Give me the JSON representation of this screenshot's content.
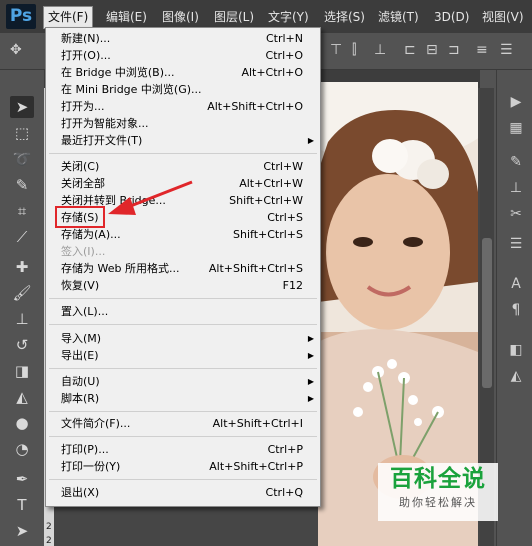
{
  "app": {
    "logo": "Ps"
  },
  "menubar": {
    "items": [
      "文件(F)",
      "编辑(E)",
      "图像(I)",
      "图层(L)",
      "文字(Y)",
      "选择(S)",
      "滤镜(T)",
      "3D(D)",
      "视图(V)"
    ]
  },
  "file_menu": {
    "items": [
      {
        "label": "新建(N)...",
        "shortcut": "Ctrl+N"
      },
      {
        "label": "打开(O)...",
        "shortcut": "Ctrl+O"
      },
      {
        "label": "在 Bridge 中浏览(B)...",
        "shortcut": "Alt+Ctrl+O"
      },
      {
        "label": "在 Mini Bridge 中浏览(G)...",
        "shortcut": ""
      },
      {
        "label": "打开为...",
        "shortcut": "Alt+Shift+Ctrl+O"
      },
      {
        "label": "打开为智能对象...",
        "shortcut": ""
      },
      {
        "label": "最近打开文件(T)",
        "shortcut": ""
      },
      {
        "label": "关闭(C)",
        "shortcut": "Ctrl+W"
      },
      {
        "label": "关闭全部",
        "shortcut": "Alt+Ctrl+W"
      },
      {
        "label": "关闭并转到 Bridge...",
        "shortcut": "Shift+Ctrl+W"
      },
      {
        "label": "存储(S)",
        "shortcut": "Ctrl+S"
      },
      {
        "label": "存储为(A)...",
        "shortcut": "Shift+Ctrl+S"
      },
      {
        "label": "签入(I)...",
        "shortcut": ""
      },
      {
        "label": "存储为 Web 所用格式...",
        "shortcut": "Alt+Shift+Ctrl+S"
      },
      {
        "label": "恢复(V)",
        "shortcut": "F12"
      },
      {
        "label": "置入(L)...",
        "shortcut": ""
      },
      {
        "label": "导入(M)",
        "shortcut": ""
      },
      {
        "label": "导出(E)",
        "shortcut": ""
      },
      {
        "label": "自动(U)",
        "shortcut": ""
      },
      {
        "label": "脚本(R)",
        "shortcut": ""
      },
      {
        "label": "文件简介(F)...",
        "shortcut": "Alt+Shift+Ctrl+I"
      },
      {
        "label": "打印(P)...",
        "shortcut": "Ctrl+P"
      },
      {
        "label": "打印一份(Y)",
        "shortcut": "Alt+Shift+Ctrl+P"
      },
      {
        "label": "退出(X)",
        "shortcut": "Ctrl+Q"
      }
    ]
  },
  "ruler": {
    "numbers": [
      "2",
      "2"
    ]
  },
  "watermark": {
    "title": "百科全说",
    "subtitle": "助你轻松解决"
  },
  "colors": {
    "highlight": "#e0262a",
    "watermark_green": "#1aa23c"
  }
}
